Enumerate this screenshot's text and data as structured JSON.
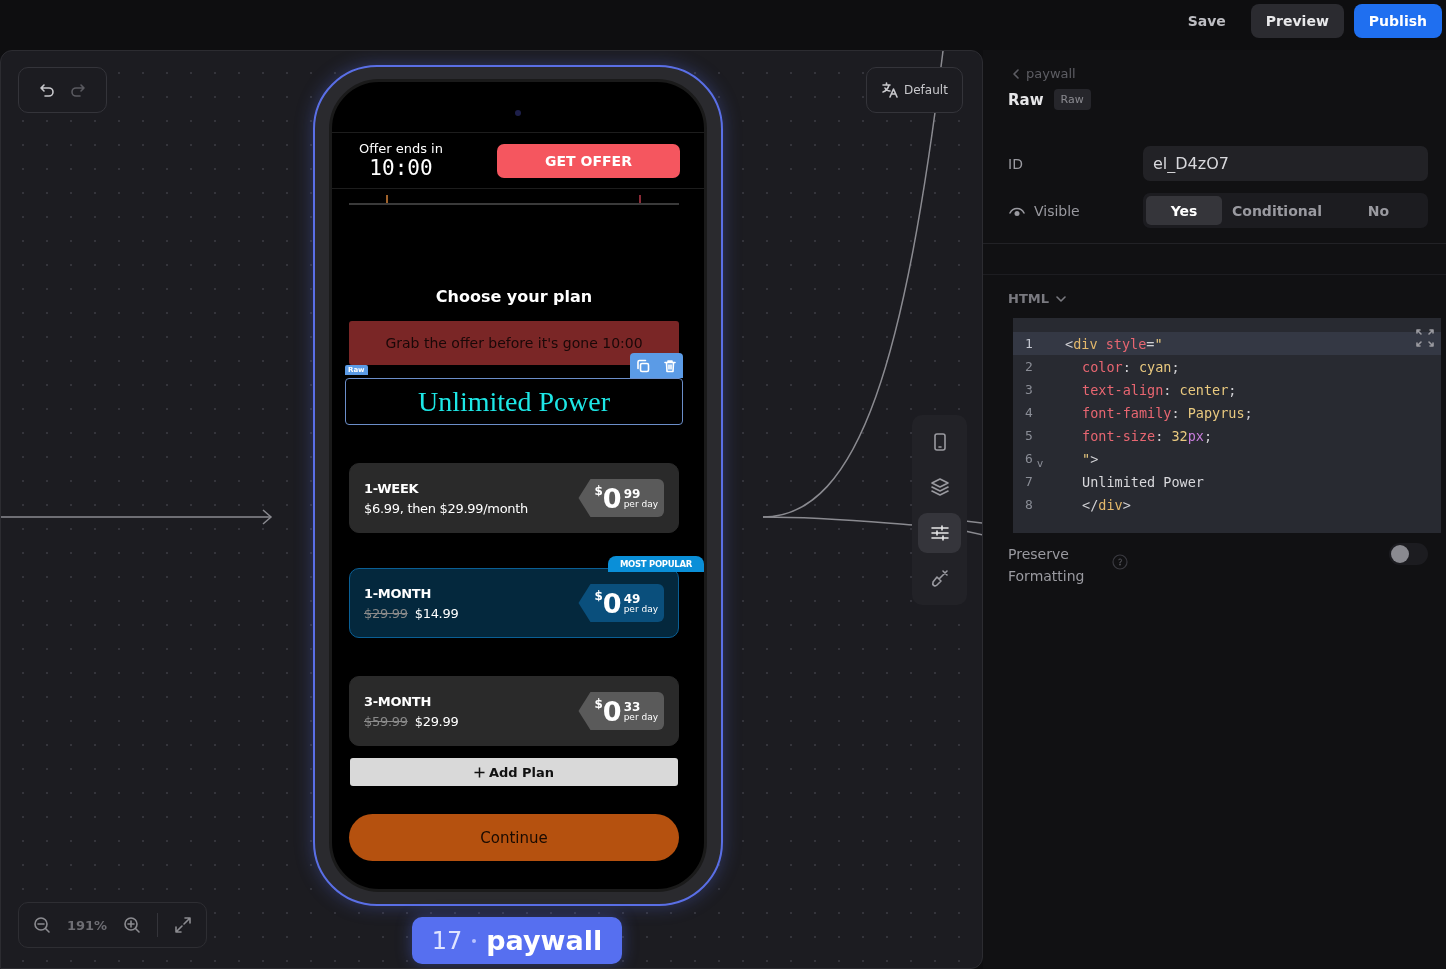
{
  "top_bar": {
    "buttons": [
      {
        "label": "Save",
        "kind": "plain"
      },
      {
        "label": "Preview",
        "kind": "secondary"
      },
      {
        "label": "Publish",
        "kind": "primary"
      }
    ]
  },
  "canvas": {
    "language_button": "Default",
    "zoom": "191%",
    "frame_label": {
      "number": "17",
      "name": "paywall"
    },
    "side_tools": [
      {
        "kind": "phone",
        "selected": false
      },
      {
        "kind": "layers",
        "selected": false
      },
      {
        "kind": "sliders",
        "selected": true
      },
      {
        "kind": "brush",
        "selected": false
      }
    ]
  },
  "phone_screen": {
    "offer_label": "Offer ends in",
    "timer": "10:00",
    "offer_button": "GET OFFER",
    "title": "Choose your plan",
    "banner": "Grab the offer before it's gone  10:00",
    "selected_element": {
      "tag": "Raw",
      "text": "Unlimited Power"
    },
    "plans": [
      {
        "kind": "intro",
        "name": "1-WEEK",
        "subtitle": "$6.99, then $29.99/month",
        "currency": "$",
        "whole": "0",
        "cents": "99",
        "unit": "per day",
        "selected": false
      },
      {
        "kind": "discount",
        "name": "1-MONTH",
        "old_price": "$29.99",
        "price": "$14.99",
        "currency": "$",
        "whole": "0",
        "cents": "49",
        "unit": "per day",
        "badge": "MOST POPULAR",
        "selected": true
      },
      {
        "kind": "discount",
        "name": "3-MONTH",
        "old_price": "$59.99",
        "price": "$29.99",
        "currency": "$",
        "whole": "0",
        "cents": "33",
        "unit": "per day",
        "selected": false
      }
    ],
    "add_plan": "Add Plan",
    "continue": "Continue"
  },
  "panel": {
    "breadcrumb": "paywall",
    "title": "Raw",
    "type_badge": "Raw",
    "id_label": "ID",
    "id_value": "el_D4zO7",
    "visible_label": "Visible",
    "visible_options": [
      {
        "label": "Yes",
        "selected": true
      },
      {
        "label": "Conditional",
        "selected": false
      },
      {
        "label": "No",
        "selected": false
      }
    ],
    "html_label": "HTML",
    "code_lines": [
      {
        "number": "1",
        "active": true,
        "indented": false,
        "tokens": [
          {
            "text": "<",
            "kind": "punct"
          },
          {
            "text": "div",
            "kind": "tag"
          },
          {
            "text": "style",
            "kind": "attr",
            "gap_before": true
          },
          {
            "text": "=",
            "kind": "punct"
          },
          {
            "text": "\"",
            "kind": "value"
          }
        ]
      },
      {
        "number": "2",
        "active": false,
        "indented": true,
        "tokens": [
          {
            "text": "color",
            "kind": "attr"
          },
          {
            "text": ": ",
            "kind": "punct"
          },
          {
            "text": "cyan",
            "kind": "value"
          },
          {
            "text": ";",
            "kind": "punct"
          }
        ]
      },
      {
        "number": "3",
        "active": false,
        "indented": true,
        "tokens": [
          {
            "text": "text-align",
            "kind": "attr"
          },
          {
            "text": ": ",
            "kind": "punct"
          },
          {
            "text": "center",
            "kind": "value"
          },
          {
            "text": ";",
            "kind": "punct"
          }
        ]
      },
      {
        "number": "4",
        "active": false,
        "indented": true,
        "tokens": [
          {
            "text": "font-family",
            "kind": "attr"
          },
          {
            "text": ": ",
            "kind": "punct"
          },
          {
            "text": "Papyrus",
            "kind": "value"
          },
          {
            "text": ";",
            "kind": "punct"
          }
        ]
      },
      {
        "number": "5",
        "active": false,
        "indented": true,
        "tokens": [
          {
            "text": "font-size",
            "kind": "attr"
          },
          {
            "text": ": ",
            "kind": "punct"
          },
          {
            "text": "32",
            "kind": "value"
          },
          {
            "text": "px",
            "kind": "unit"
          },
          {
            "text": ";",
            "kind": "punct"
          }
        ]
      },
      {
        "number": "6",
        "active": false,
        "indented": true,
        "fold_marker": "v",
        "tokens": [
          {
            "text": "\"",
            "kind": "value"
          },
          {
            "text": ">",
            "kind": "punct"
          }
        ]
      },
      {
        "number": "7",
        "active": false,
        "indented": true,
        "tokens": [
          {
            "text": "Unlimited Power",
            "kind": "text"
          }
        ]
      },
      {
        "number": "8",
        "active": false,
        "indented": true,
        "tokens": [
          {
            "text": "</",
            "kind": "punct"
          },
          {
            "text": "div",
            "kind": "tag"
          },
          {
            "text": ">",
            "kind": "punct"
          }
        ]
      }
    ],
    "preserve_label": "Preserve Formatting",
    "preserve_on": false
  }
}
